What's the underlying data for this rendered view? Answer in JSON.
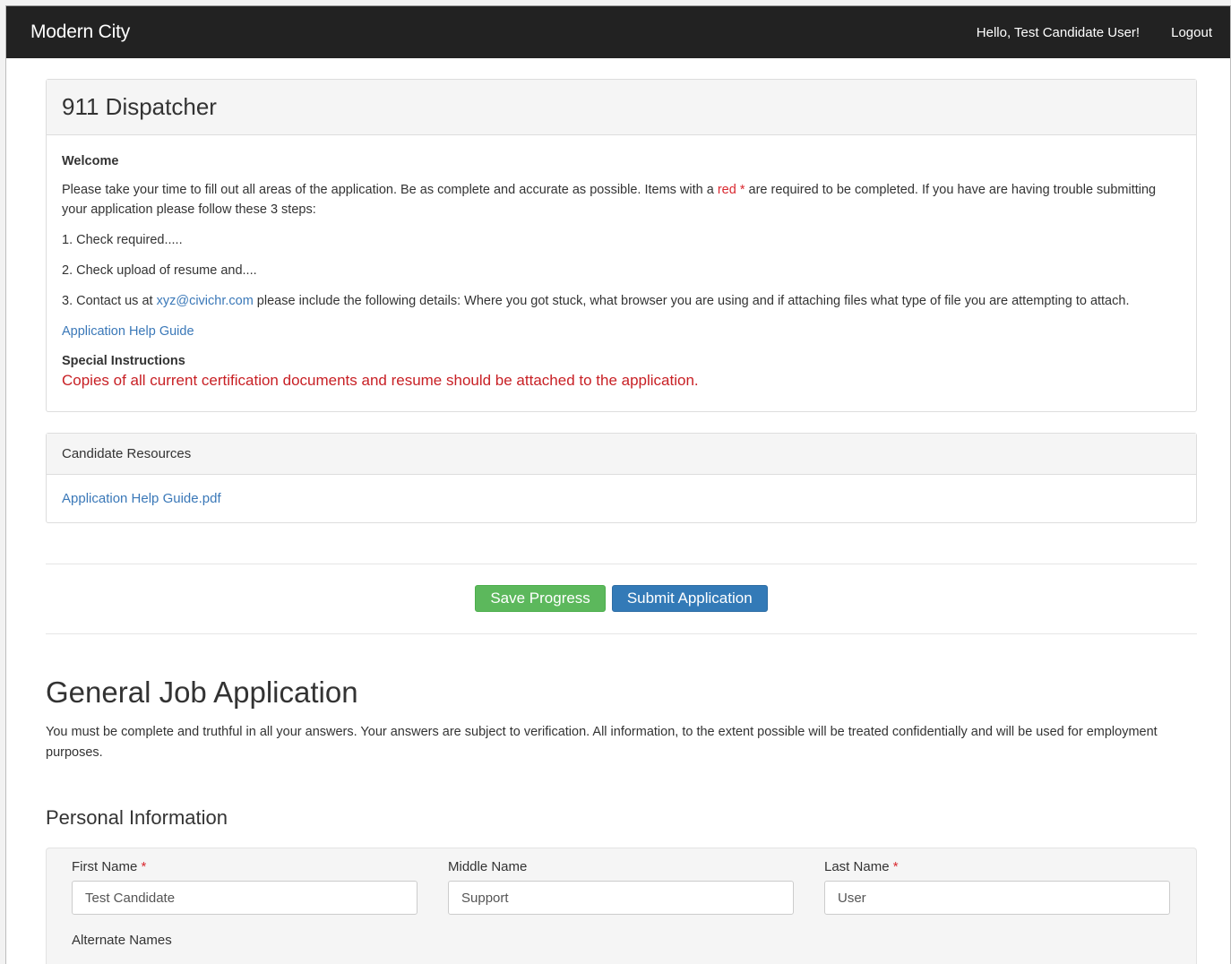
{
  "navbar": {
    "brand": "Modern City",
    "greeting": "Hello, Test Candidate User!",
    "logout": "Logout"
  },
  "job": {
    "title": "911 Dispatcher",
    "welcome_heading": "Welcome",
    "intro_before": "Please take your time to fill out all areas of the application. Be as complete and accurate as possible. Items with a ",
    "intro_red": "red *",
    "intro_after": " are required to be completed. If you have are having trouble submitting your application please follow these 3 steps:",
    "step1": "1. Check required.....",
    "step2": "2. Check upload of resume and....",
    "step3_before": "3. Contact us at ",
    "step3_email": "xyz@civichr.com",
    "step3_after": " please include the following details: Where you got stuck, what browser you are using and if attaching files what type of file you are attempting to attach.",
    "help_link": "Application Help Guide",
    "special_heading": "Special Instructions",
    "special_text": "Copies of all current certification documents and resume should be attached to the application."
  },
  "resources": {
    "heading": "Candidate Resources",
    "file_link": "Application Help Guide.pdf"
  },
  "actions": {
    "save_label": "Save Progress",
    "submit_label": "Submit Application"
  },
  "form": {
    "title": "General Job Application",
    "intro": "You must be complete and truthful in all your answers.  Your answers are subject to verification.  All information, to the extent possible will be treated confidentially and will be used for employment purposes.",
    "section_title": "Personal Information",
    "required_mark": "*",
    "first_name_label": "First Name",
    "first_name_value": "Test Candidate",
    "middle_name_label": "Middle Name",
    "middle_name_value": "Support",
    "last_name_label": "Last Name",
    "last_name_value": "User",
    "alternate_names_label": "Alternate Names"
  }
}
